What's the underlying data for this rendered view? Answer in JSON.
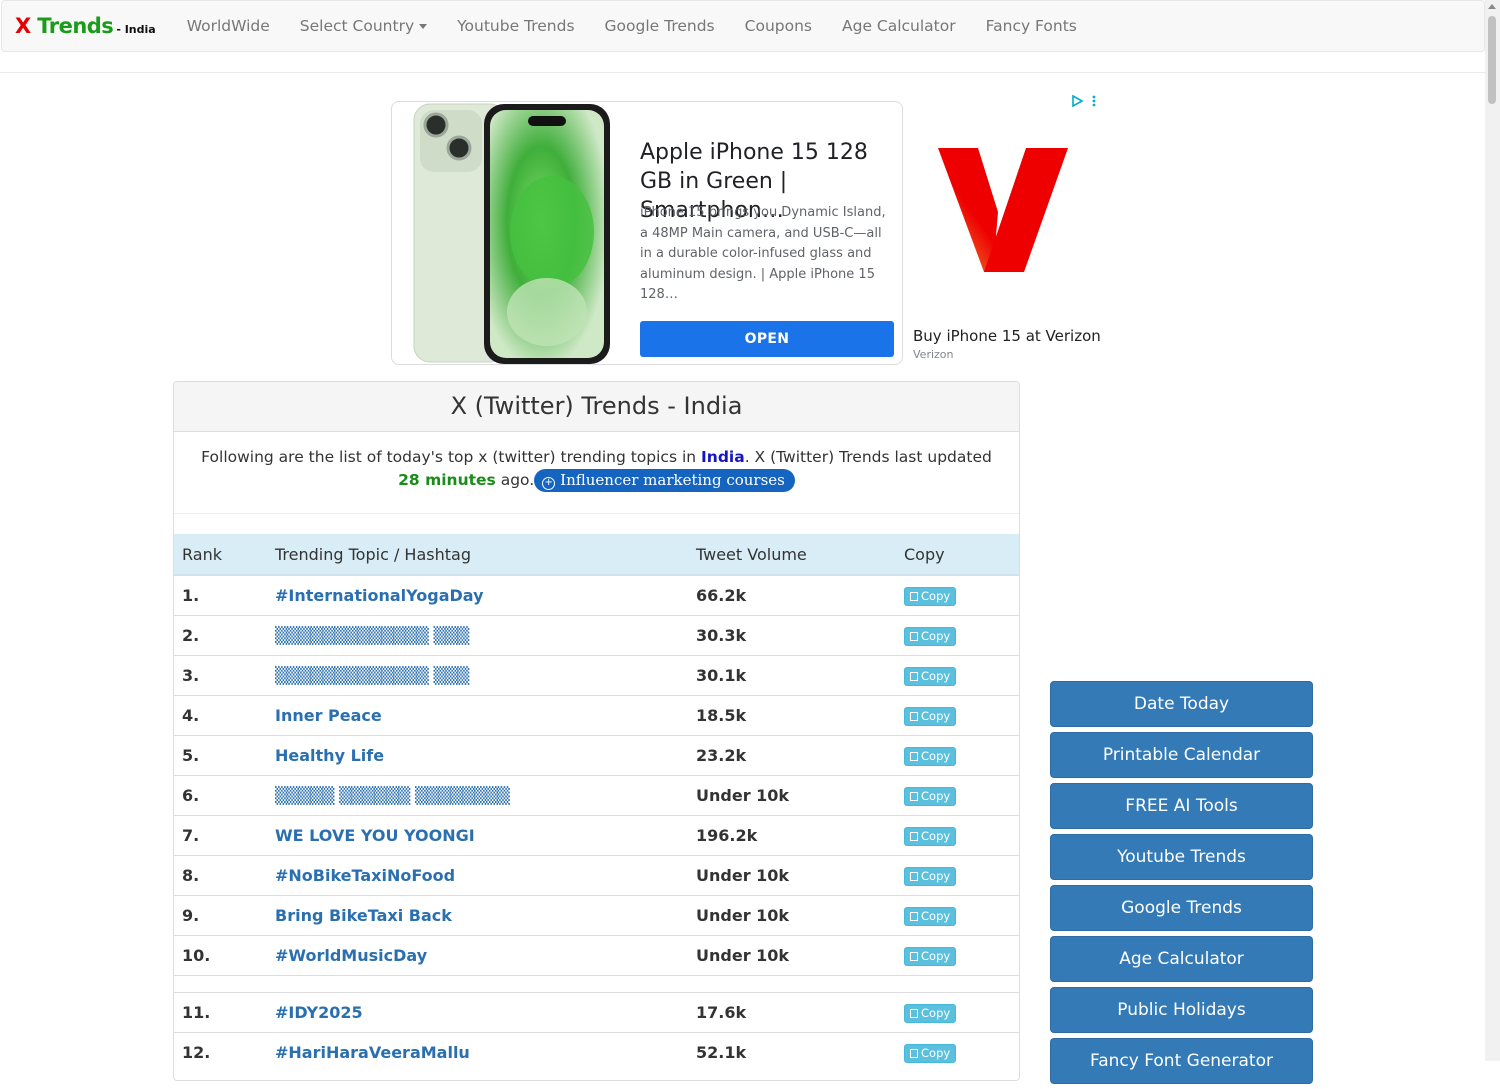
{
  "brand": {
    "x": "X",
    "trends": "Trends",
    "country": "- India"
  },
  "nav": {
    "items": [
      "WorldWide",
      "Select Country",
      "Youtube Trends",
      "Google Trends",
      "Coupons",
      "Age Calculator",
      "Fancy Fonts"
    ]
  },
  "ad": {
    "title": "Apple iPhone 15 128 GB in Green | Smartphon…",
    "description": "iPhone 15 brings you Dynamic Island, a 48MP Main camera, and USB-C—all in a durable color-infused glass and aluminum design. | Apple iPhone 15 128…",
    "button": "OPEN",
    "side_title": "Buy iPhone 15 at Verizon",
    "side_advertiser": "Verizon"
  },
  "panel": {
    "heading": "X (Twitter) Trends - India",
    "intro_before": "Following are the list of today's top x (twitter) trending topics in ",
    "country": "India",
    "intro_middle": ". X (Twitter) Trends last updated ",
    "updated": "28 minutes",
    "intro_after": " ago.",
    "course_button": "Influencer marketing courses"
  },
  "table": {
    "headers": {
      "rank": "Rank",
      "topic": "Trending Topic / Hashtag",
      "volume": "Tweet Volume",
      "copy": "Copy"
    },
    "copy_label": "Copy",
    "rows": [
      {
        "rank": "1.",
        "topic": "#InternationalYogaDay",
        "volume": "66.2k"
      },
      {
        "rank": "2.",
        "topic": "▒▒▒▒▒▒▒▒▒▒▒▒▒ ▒▒▒",
        "volume": "30.3k"
      },
      {
        "rank": "3.",
        "topic": "▒▒▒▒▒▒▒▒▒▒▒▒▒ ▒▒▒",
        "volume": "30.1k"
      },
      {
        "rank": "4.",
        "topic": "Inner Peace",
        "volume": "18.5k"
      },
      {
        "rank": "5.",
        "topic": "Healthy Life",
        "volume": "23.2k"
      },
      {
        "rank": "6.",
        "topic": "▒▒▒▒▒ ▒▒▒▒▒▒ ▒▒▒▒▒▒▒▒",
        "volume": "Under 10k"
      },
      {
        "rank": "7.",
        "topic": "WE LOVE YOU YOONGI",
        "volume": "196.2k"
      },
      {
        "rank": "8.",
        "topic": "#NoBikeTaxiNoFood",
        "volume": "Under 10k"
      },
      {
        "rank": "9.",
        "topic": "Bring BikeTaxi Back",
        "volume": "Under 10k"
      },
      {
        "rank": "10.",
        "topic": "#WorldMusicDay",
        "volume": "Under 10k"
      },
      {
        "rank": "11.",
        "topic": "#IDY2025",
        "volume": "17.6k"
      },
      {
        "rank": "12.",
        "topic": "#HariHaraVeeraMallu",
        "volume": "52.1k"
      }
    ]
  },
  "sidebar": {
    "buttons": [
      "Date Today",
      "Printable Calendar",
      "FREE AI Tools",
      "Youtube Trends",
      "Google Trends",
      "Age Calculator",
      "Public Holidays",
      "Fancy Font Generator"
    ]
  },
  "colors": {
    "brand_red": "#e60000",
    "brand_green": "#1a9c1a",
    "link_blue": "#2a6fb0",
    "sidebar_button": "#337ab7",
    "copy_button": "#5bc0de",
    "table_header": "#d9edf7",
    "ad_button": "#1a73e8",
    "verizon_red": "#ee0000"
  }
}
